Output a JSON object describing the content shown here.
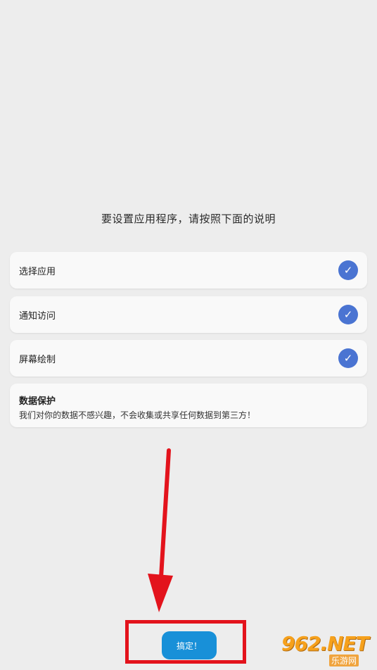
{
  "instructions": {
    "title": "要设置应用程序，请按照下面的说明"
  },
  "steps": [
    {
      "label": "选择应用",
      "checked": true,
      "check_glyph": "✓"
    },
    {
      "label": "通知访问",
      "checked": true,
      "check_glyph": "✓"
    },
    {
      "label": "屏幕绘制",
      "checked": true,
      "check_glyph": "✓"
    }
  ],
  "privacy": {
    "title": "数据保护",
    "text": "我们对你的数据不感兴趣，不会收集或共享任何数据到第三方！"
  },
  "footer": {
    "done_label": "搞定！"
  },
  "watermark": {
    "brand": "962.NET",
    "sub": "乐游网"
  },
  "colors": {
    "background": "#ededed",
    "check": "#4a74d2",
    "button": "#1890d8",
    "annotation": "#e3131c"
  }
}
